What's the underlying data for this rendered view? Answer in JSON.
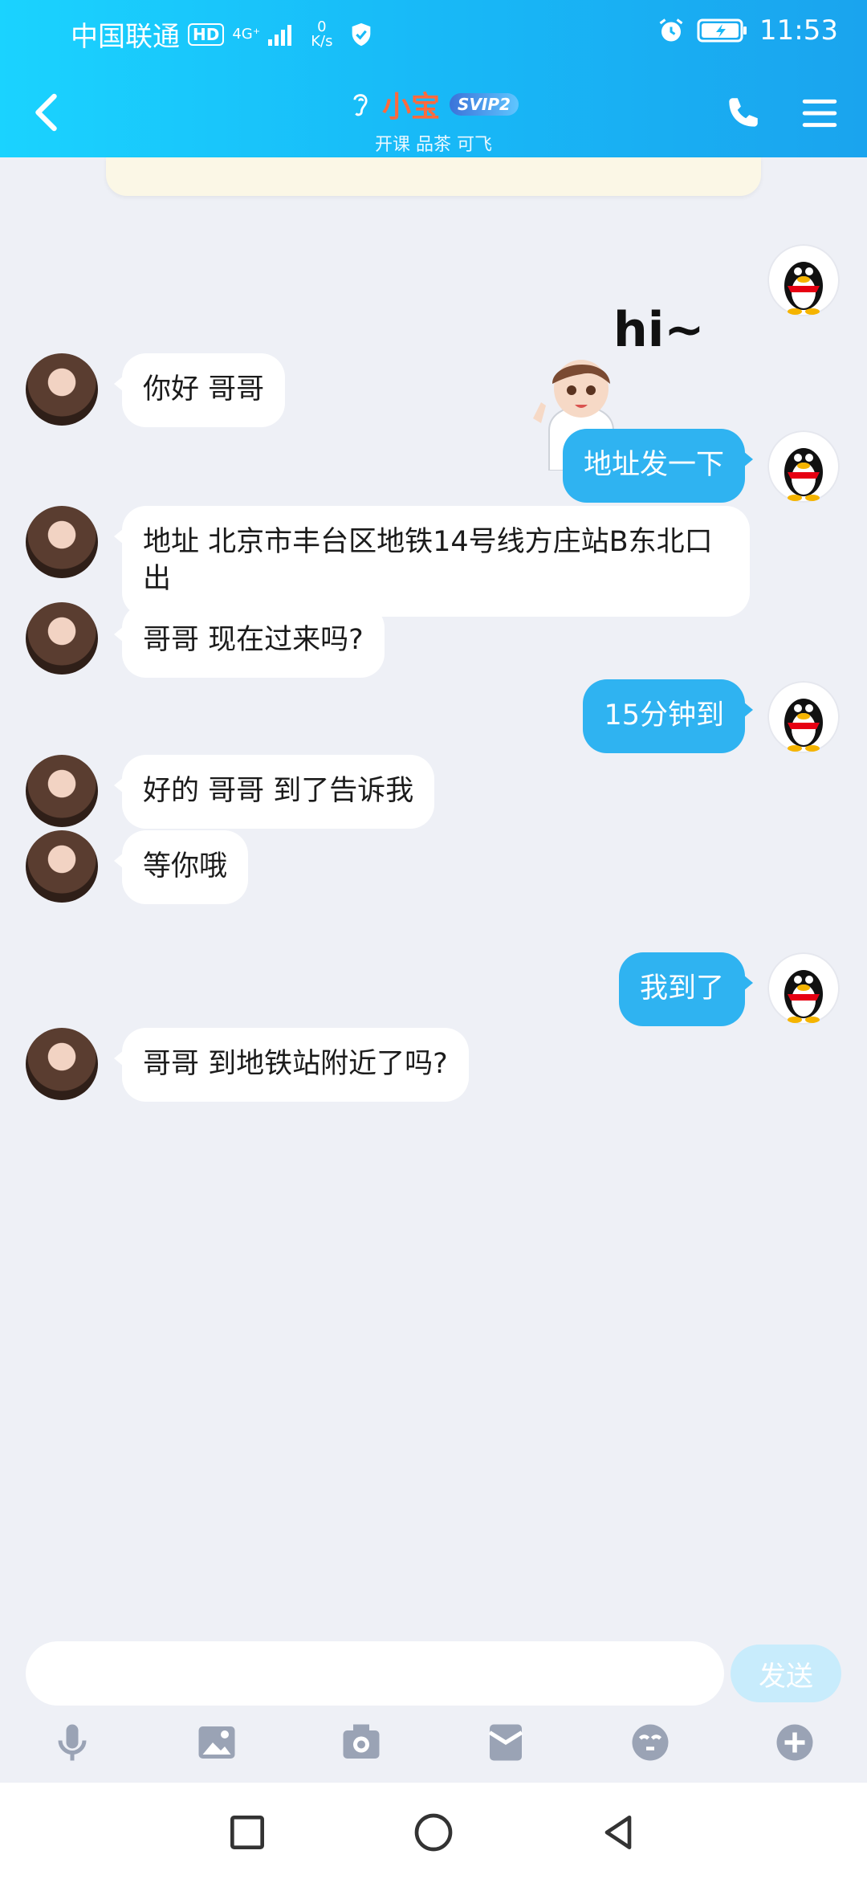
{
  "status": {
    "carrier": "中国联通",
    "hd": "HD",
    "network": "4G⁺",
    "speed_value": "0",
    "speed_unit": "K/s",
    "time": "11:53"
  },
  "header": {
    "name": "小宝",
    "svip": "SVIP2",
    "subtitle": "开课 品茶  可飞"
  },
  "messages": [
    {
      "side": "in",
      "text": "你好  哥哥"
    },
    {
      "side": "out",
      "text": "地址发一下"
    },
    {
      "side": "in",
      "text": "地址 北京市丰台区地铁14号线方庄站B东北口出"
    },
    {
      "side": "in",
      "text": "哥哥  现在过来吗?"
    },
    {
      "side": "out",
      "text": "15分钟到"
    },
    {
      "side": "in",
      "text": "好的   哥哥  到了告诉我"
    },
    {
      "side": "in",
      "text": "等你哦"
    },
    {
      "side": "out",
      "text": "我到了"
    },
    {
      "side": "in",
      "text": "哥哥  到地铁站附近了吗?"
    }
  ],
  "sticker": {
    "text": "hi~"
  },
  "composer": {
    "placeholder": "",
    "send_label": "发送"
  },
  "toolbar": [
    "voice-icon",
    "image-icon",
    "camera-icon",
    "red-packet-icon",
    "emoji-icon",
    "plus-icon"
  ],
  "colors": {
    "header_start": "#1ad3ff",
    "header_end": "#1aa4ee",
    "bubble_out": "#2fb3f1",
    "bubble_in": "#ffffff",
    "name": "#ff6a3d",
    "background": "#eef0f6"
  }
}
